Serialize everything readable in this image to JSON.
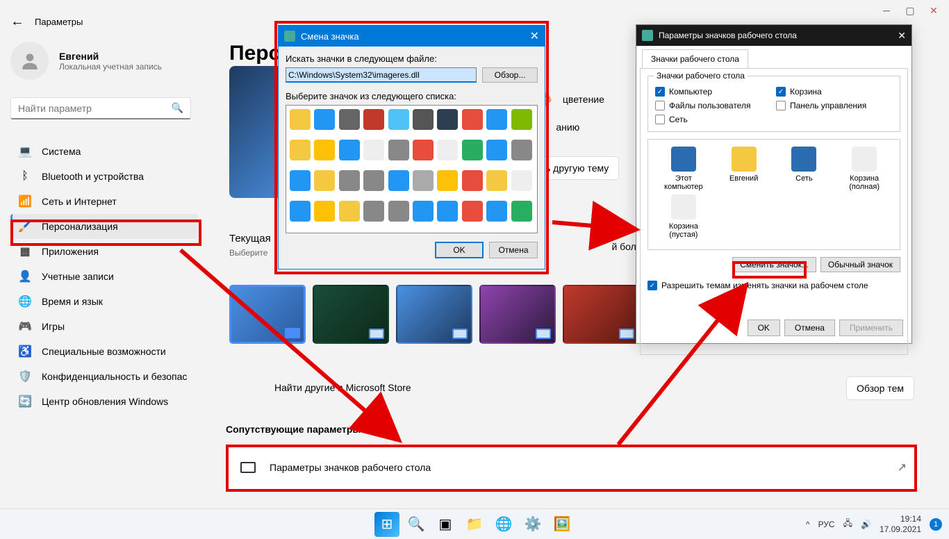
{
  "header": {
    "title": "Параметры"
  },
  "user": {
    "name": "Евгений",
    "sub": "Локальная учетная запись"
  },
  "search": {
    "placeholder": "Найти параметр"
  },
  "nav": {
    "items": [
      {
        "label": "Система",
        "icon": "💻"
      },
      {
        "label": "Bluetooth и устройства",
        "icon": "ᛒ"
      },
      {
        "label": "Сеть и Интернет",
        "icon": "📶"
      },
      {
        "label": "Персонализация",
        "icon": "🖌️"
      },
      {
        "label": "Приложения",
        "icon": "▦"
      },
      {
        "label": "Учетные записи",
        "icon": "👤"
      },
      {
        "label": "Время и язык",
        "icon": "🌐"
      },
      {
        "label": "Игры",
        "icon": "🎮"
      },
      {
        "label": "Специальные возможности",
        "icon": "♿"
      },
      {
        "label": "Конфиденциальность и безопас",
        "icon": "🛡️"
      },
      {
        "label": "Центр обновления Windows",
        "icon": "🔄"
      }
    ]
  },
  "main": {
    "title": "Персо",
    "links": {
      "color": "цветение",
      "default": "анию"
    },
    "choose_theme": "ь другую тему",
    "theme_section": {
      "title": "Текущая",
      "sub": "Выберите"
    },
    "store_link": "Найти другие                  в Microsoft Store",
    "overview_btn": "Обзор тем",
    "related_title": "Сопутствующие параметры",
    "related_card": "Параметры значков рабочего стола"
  },
  "dialog1": {
    "title": "Смена значка",
    "search_label": "Искать значки в следующем файле:",
    "path": "C:\\Windows\\System32\\imageres.dll",
    "browse": "Обзор...",
    "select_label": "Выберите значок из следующего списка:",
    "ok": "OK",
    "cancel": "Отмена",
    "icon_colors": [
      "#f5c842",
      "#2196f3",
      "#666",
      "#c0392b",
      "#4fc3f7",
      "#555",
      "#2c3e50",
      "#e74c3c",
      "#2196f3",
      "#7fba00",
      "#f5c842",
      "#ffc107",
      "#2196f3",
      "#eee",
      "#888",
      "#e74c3c",
      "#eee",
      "#27ae60",
      "#2196f3",
      "#888",
      "#2196f3",
      "#f5c842",
      "#888",
      "#888",
      "#2196f3",
      "#aaa",
      "#ffc107",
      "#e74c3c",
      "#f5c842",
      "#eee",
      "#2196f3",
      "#ffc107",
      "#f5c842",
      "#888",
      "#888",
      "#2196f3",
      "#2196f3",
      "#e74c3c",
      "#2196f3",
      "#27ae60"
    ]
  },
  "dialog2": {
    "title": "Параметры значков рабочего стола",
    "tab": "Значки рабочего стола",
    "group": "Значки рабочего стола",
    "checks": [
      {
        "label": "Компьютер",
        "checked": true
      },
      {
        "label": "Корзина",
        "checked": true
      },
      {
        "label": "Файлы пользователя",
        "checked": false
      },
      {
        "label": "Панель управления",
        "checked": false
      },
      {
        "label": "Сеть",
        "checked": false
      }
    ],
    "icons": [
      {
        "label": "Этот компьютер",
        "color": "#2b6cb0"
      },
      {
        "label": "Евгений",
        "color": "#f5c842"
      },
      {
        "label": "Сеть",
        "color": "#2b6cb0"
      },
      {
        "label": "Корзина (полная)",
        "color": "#eee"
      },
      {
        "label": "Корзина (пустая)",
        "color": "#eee"
      }
    ],
    "change_btn": "Сменить значок...",
    "default_btn": "Обычный значок",
    "allow": "Разрешить темам изменять значки на рабочем столе",
    "ok": "OK",
    "cancel": "Отмена",
    "apply": "Применить"
  },
  "taskbar": {
    "lang": "РУС",
    "time": "19:14",
    "date": "17.09.2021"
  }
}
